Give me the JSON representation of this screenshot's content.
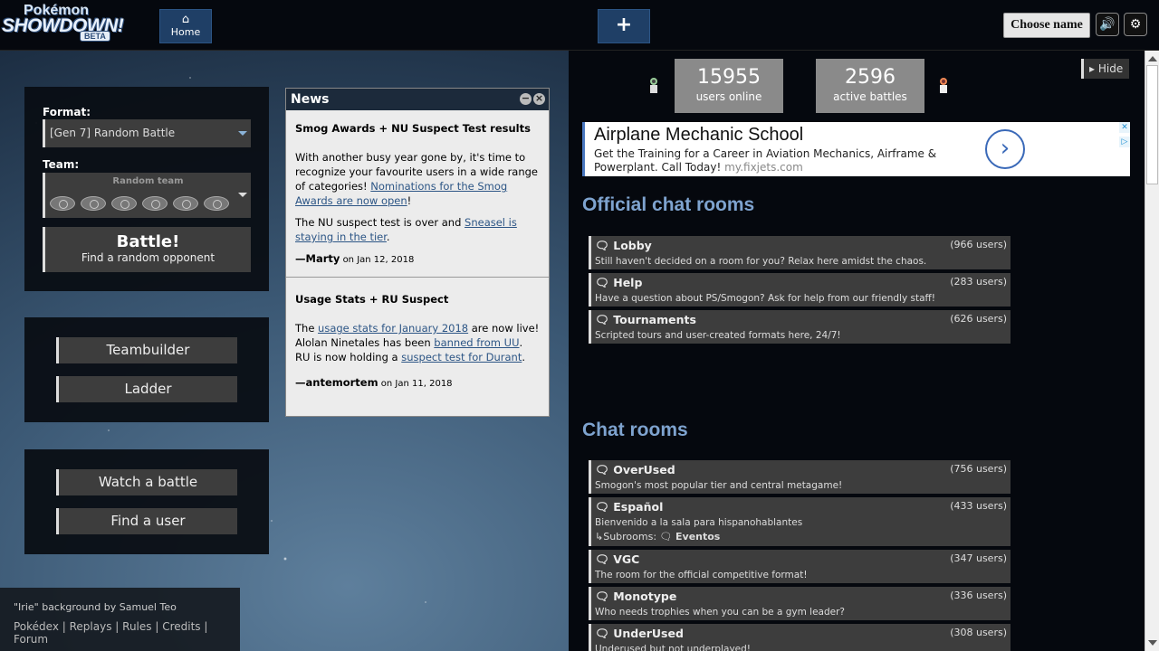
{
  "header": {
    "logo_line1": "Pokémon",
    "logo_line2": "SHOWDOWN!",
    "logo_badge": "BETA",
    "home_icon": "⌂",
    "home_label": "Home",
    "new_tab_icon": "+",
    "choose_name": "Choose name",
    "sound_icon": "🔊",
    "settings_icon": "⚙"
  },
  "mainmenu": {
    "format_label": "Format:",
    "format_value": "[Gen 7] Random Battle",
    "team_label": "Team:",
    "team_value": "Random team",
    "battle_label": "Battle!",
    "battle_sub": "Find a random opponent",
    "teambuilder": "Teambuilder",
    "ladder": "Ladder",
    "watch": "Watch a battle",
    "find_user": "Find a user"
  },
  "news": {
    "title": "News",
    "min_icon": "−",
    "close_icon": "×",
    "articles": [
      {
        "title": "Smog Awards + NU Suspect Test results",
        "p1a": "With another busy year gone by, it's time to recognize your favourite users in a wide range of categories! ",
        "p1link": "Nominations for the Smog Awards are now open",
        "p1b": "!",
        "p2a": "The NU suspect test is over and ",
        "p2link": "Sneasel is staying in the tier",
        "p2b": ".",
        "author": "—Marty",
        "date": "on Jan 12, 2018"
      },
      {
        "title": "Usage Stats + RU Suspect",
        "p1a": "The ",
        "p1link": "usage stats for January 2018",
        "p1b": " are now live!",
        "p2a": "Alolan Ninetales has been ",
        "p2link": "banned from UU",
        "p2b": ".",
        "p3a": "RU is now holding a ",
        "p3link": "suspect test for Durant",
        "p3b": ".",
        "author": "—antemortem",
        "date": "on Jan 11, 2018"
      }
    ]
  },
  "footer": {
    "credit": "\"Irie\" background by Samuel Teo",
    "links": [
      "Pokédex",
      "Replays",
      "Rules",
      "Credits",
      "Forum"
    ],
    "separator": " | "
  },
  "stats": {
    "users": "15955",
    "users_label": "users online",
    "battles": "2596",
    "battles_label": "active battles",
    "hide": "Hide"
  },
  "ad": {
    "title": "Airplane Mechanic School",
    "line1": "Get the Training for a Career in Aviation Mechanics, Airframe & Powerplant.",
    "line2": "Call Today!",
    "url": "my.fixjets.com",
    "arrow": "›",
    "close_icon": "✕",
    "info_icon": "▷"
  },
  "rooms": {
    "official_title": "Official chat rooms",
    "chat_title": "Chat rooms",
    "chat_icon": "🗨",
    "official": [
      {
        "name": "Lobby",
        "users": "(966 users)",
        "desc": "Still haven't decided on a room for you? Relax here amidst the chaos."
      },
      {
        "name": "Help",
        "users": "(283 users)",
        "desc": "Have a question about PS/Smogon? Ask for help from our friendly staff!"
      },
      {
        "name": "Tournaments",
        "users": "(626 users)",
        "desc": "Scripted tours and user-created formats here, 24/7!"
      }
    ],
    "chat": [
      {
        "name": "OverUsed",
        "users": "(756 users)",
        "desc": "Smogon's most popular tier and central metagame!"
      },
      {
        "name": "Español",
        "users": "(433 users)",
        "desc": "Bienvenido a la sala para hispanohablantes",
        "sub_label": "↳Subrooms:",
        "sub": "Eventos"
      },
      {
        "name": "VGC",
        "users": "(347 users)",
        "desc": "The room for the official competitive format!"
      },
      {
        "name": "Monotype",
        "users": "(336 users)",
        "desc": "Who needs trophies when you can be a gym leader?"
      },
      {
        "name": "UnderUsed",
        "users": "(308 users)",
        "desc": "Underused but not underplayed!"
      }
    ]
  }
}
